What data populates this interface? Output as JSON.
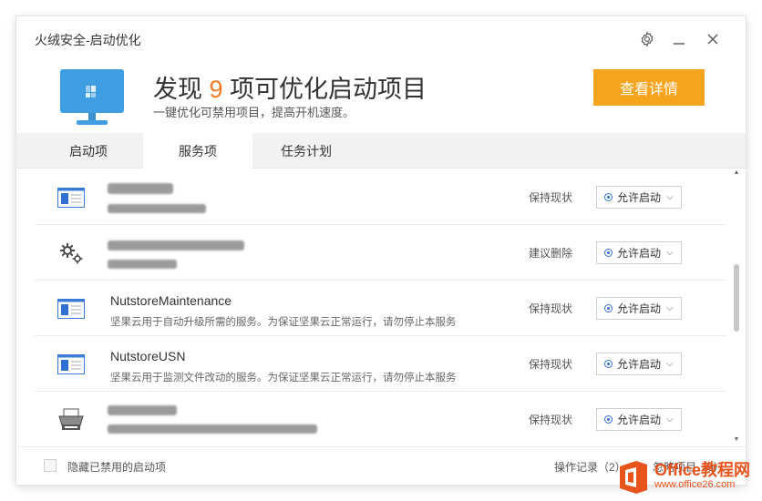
{
  "window": {
    "title": "火绒安全-启动优化"
  },
  "titlebar": {
    "settings_icon": "gear-icon",
    "minimize_glyph": "_",
    "close_glyph": "×"
  },
  "header": {
    "headline_prefix": "发现 ",
    "count": "9",
    "headline_suffix": " 项可优化启动项目",
    "subline": "一键优化可禁用项目，提高开机速度。",
    "detail_button": "查看详情",
    "accent_color": "#f6a31d"
  },
  "tabs": [
    {
      "label": "启动项",
      "active": false
    },
    {
      "label": "服务项",
      "active": true
    },
    {
      "label": "任务计划",
      "active": false
    }
  ],
  "rows": [
    {
      "icon": "window-app-icon",
      "name": "",
      "desc": "",
      "status": "保持现状",
      "select": "允许启动"
    },
    {
      "icon": "gears-icon",
      "name": "",
      "desc": "",
      "status": "建议删除",
      "select": "允许启动"
    },
    {
      "icon": "window-app-icon",
      "name": "NutstoreMaintenance",
      "desc": "坚果云用于自动升级所需的服务。为保证坚果云正常运行，请勿停止本服务",
      "status": "保持现状",
      "select": "允许启动"
    },
    {
      "icon": "window-app-icon",
      "name": "NutstoreUSN",
      "desc": "坚果云用于监测文件改动的服务。为保证坚果云正常运行，请勿停止本服务",
      "status": "保持现状",
      "select": "允许启动"
    },
    {
      "icon": "printer-icon",
      "name": "",
      "desc": "",
      "status": "保持现状",
      "select": "允许启动"
    }
  ],
  "footer": {
    "hide_disabled_label": "隐藏已禁用的启动项",
    "log_label": "操作记录（2）",
    "ignore_label": "忽略项目（0）"
  },
  "watermark": {
    "brand": "Office教程网",
    "url": "www.office26.com"
  }
}
